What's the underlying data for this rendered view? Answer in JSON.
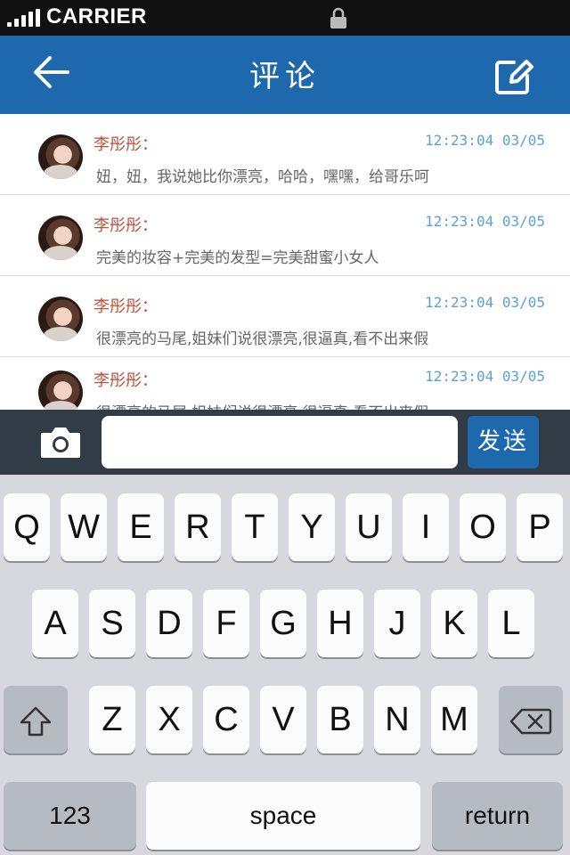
{
  "status_bar": {
    "carrier": "CARRIER"
  },
  "header": {
    "title": "评论",
    "back_icon": "arrow-left-icon",
    "edit_icon": "edit-icon"
  },
  "comments": [
    {
      "author": "李彤彤：",
      "time": "12:23:04 03/05",
      "text": "妞，妞，我说她比你漂亮，哈哈，嘿嘿，给哥乐呵"
    },
    {
      "author": "李彤彤：",
      "time": "12:23:04 03/05",
      "text": "完美的妆容+完美的发型=完美甜蜜小女人"
    },
    {
      "author": "李彤彤：",
      "time": "12:23:04 03/05",
      "text": "很漂亮的马尾,姐妹们说很漂亮,很逼真,看不出来假"
    },
    {
      "author": "李彤彤：",
      "time": "12:23:04 03/05",
      "text": "很漂亮的马尾,姐妹们说很漂亮,很逼真,看不出来假"
    }
  ],
  "composer": {
    "input_value": "",
    "send_label": "发送",
    "camera_icon": "camera-icon"
  },
  "keyboard": {
    "row1": [
      "Q",
      "W",
      "E",
      "R",
      "T",
      "Y",
      "U",
      "I",
      "O",
      "P"
    ],
    "row2": [
      "A",
      "S",
      "D",
      "F",
      "G",
      "H",
      "J",
      "K",
      "L"
    ],
    "row3": [
      "Z",
      "X",
      "C",
      "V",
      "B",
      "N",
      "M"
    ],
    "numbers_label": "123",
    "space_label": "space",
    "return_label": "return",
    "shift_icon": "shift-icon",
    "backspace_icon": "backspace-icon"
  },
  "colors": {
    "header_bg": "#1e68ae",
    "author": "#c0523c",
    "time": "#5aa2d6",
    "input_bar_bg": "#323c46"
  }
}
